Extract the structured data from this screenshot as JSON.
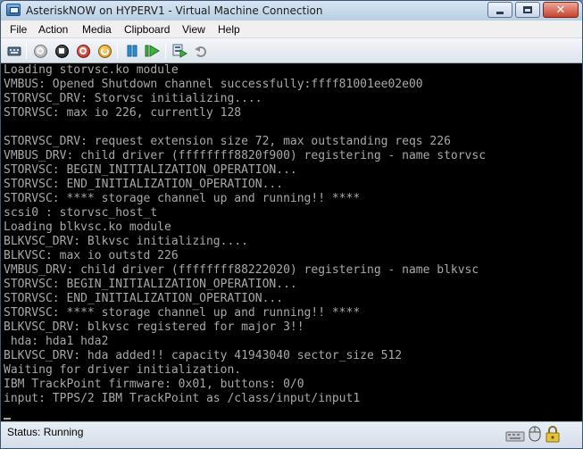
{
  "window": {
    "title": "AsteriskNOW on HYPERV1 - Virtual Machine Connection"
  },
  "menu": {
    "items": [
      "File",
      "Action",
      "Media",
      "Clipboard",
      "View",
      "Help"
    ]
  },
  "toolbar": {
    "buttons": [
      "ctrl-alt-del-icon",
      "start-icon",
      "turn-off-icon",
      "shut-down-icon",
      "save-icon",
      "pause-icon",
      "reset-icon",
      "snapshot-icon",
      "revert-icon"
    ]
  },
  "console": {
    "lines": [
      "Loading storvsc.ko module",
      "VMBUS: Opened Shutdown channel successfully:ffff81001ee02e00",
      "STORVSC_DRV: Storvsc initializing....",
      "STORVSC: max io 226, currently 128",
      "",
      "STORVSC_DRV: request extension size 72, max outstanding reqs 226",
      "VMBUS_DRV: child driver (ffffffff8820f900) registering - name storvsc",
      "STORVSC: BEGIN_INITIALIZATION_OPERATION...",
      "STORVSC: END_INITIALIZATION_OPERATION...",
      "STORVSC: **** storage channel up and running!! ****",
      "scsi0 : storvsc_host_t",
      "Loading blkvsc.ko module",
      "BLKVSC_DRV: Blkvsc initializing....",
      "BLKVSC: max io outstd 226",
      "VMBUS_DRV: child driver (ffffffff88222020) registering - name blkvsc",
      "STORVSC: BEGIN_INITIALIZATION_OPERATION...",
      "STORVSC: END_INITIALIZATION_OPERATION...",
      "STORVSC: **** storage channel up and running!! ****",
      "BLKVSC_DRV: blkvsc registered for major 3!!",
      " hda: hda1 hda2",
      "BLKVSC_DRV: hda added!! capacity 41943040 sector_size 512",
      "Waiting for driver initialization.",
      "IBM TrackPoint firmware: 0x01, buttons: 0/0",
      "input: TPPS/2 IBM TrackPoint as /class/input/input1"
    ]
  },
  "status": {
    "text": "Status: Running",
    "icons": [
      "keyboard-icon",
      "mouse-icon",
      "lock-icon"
    ]
  }
}
